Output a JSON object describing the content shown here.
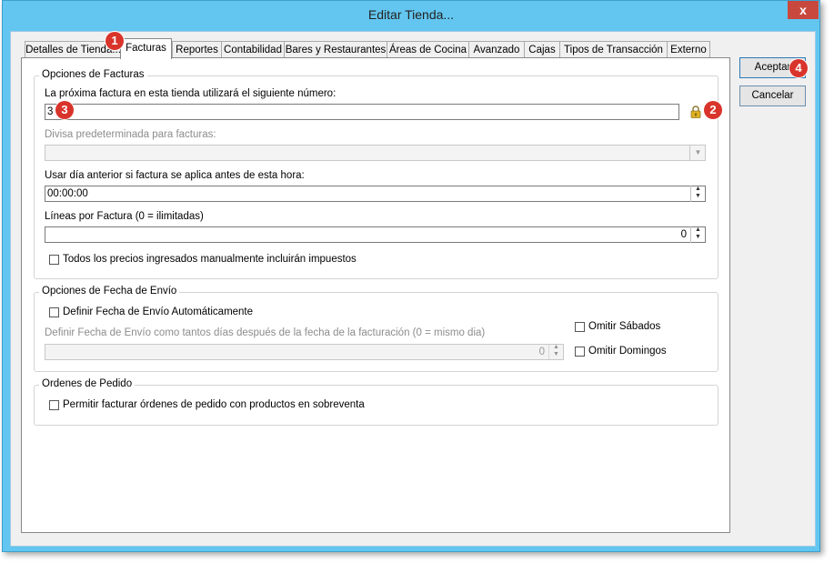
{
  "window": {
    "title": "Editar Tienda...",
    "close_label": "x"
  },
  "tabs": [
    {
      "label": "Detalles de Tienda..."
    },
    {
      "label": "Facturas"
    },
    {
      "label": "Reportes"
    },
    {
      "label": "Contabilidad"
    },
    {
      "label": "Bares y Restaurantes"
    },
    {
      "label": "Áreas de Cocina"
    },
    {
      "label": "Avanzado"
    },
    {
      "label": "Cajas"
    },
    {
      "label": "Tipos de Transacción"
    },
    {
      "label": "Externo"
    }
  ],
  "invoice_options": {
    "legend": "Opciones de Facturas",
    "next_invoice_label": "La próxima factura en esta tienda utilizará el siguiente número:",
    "next_invoice_value": "3",
    "currency_label": "Divisa predeterminada para facturas:",
    "currency_value": "",
    "prev_day_label": "Usar día anterior si factura se aplica antes de esta hora:",
    "prev_day_value": "00:00:00",
    "lines_label": "Líneas por Factura (0 = ilimitadas)",
    "lines_value": "0",
    "tax_checkbox_label": "Todos los precios ingresados manualmente incluirán impuestos"
  },
  "ship_options": {
    "legend": "Opciones de Fecha de Envío",
    "auto_label": "Definir Fecha de Envío Automáticamente",
    "days_label": "Definir Fecha de Envío como tantos días después de la fecha de la facturación (0 = mismo dia)",
    "days_value": "0",
    "skip_saturday": "Omitir Sábados",
    "skip_sunday": "Omitir Domingos"
  },
  "purchase_orders": {
    "legend": "Ordenes de Pedido",
    "oversell_label": "Permitir facturar órdenes de pedido con productos en sobreventa"
  },
  "buttons": {
    "accept": "Aceptar",
    "cancel": "Cancelar"
  },
  "badges": [
    "1",
    "2",
    "3",
    "4"
  ],
  "colors": {
    "titlebar": "#63c6f0",
    "close": "#c8483d",
    "badge": "#d9342b",
    "lock": "#e0b020"
  }
}
